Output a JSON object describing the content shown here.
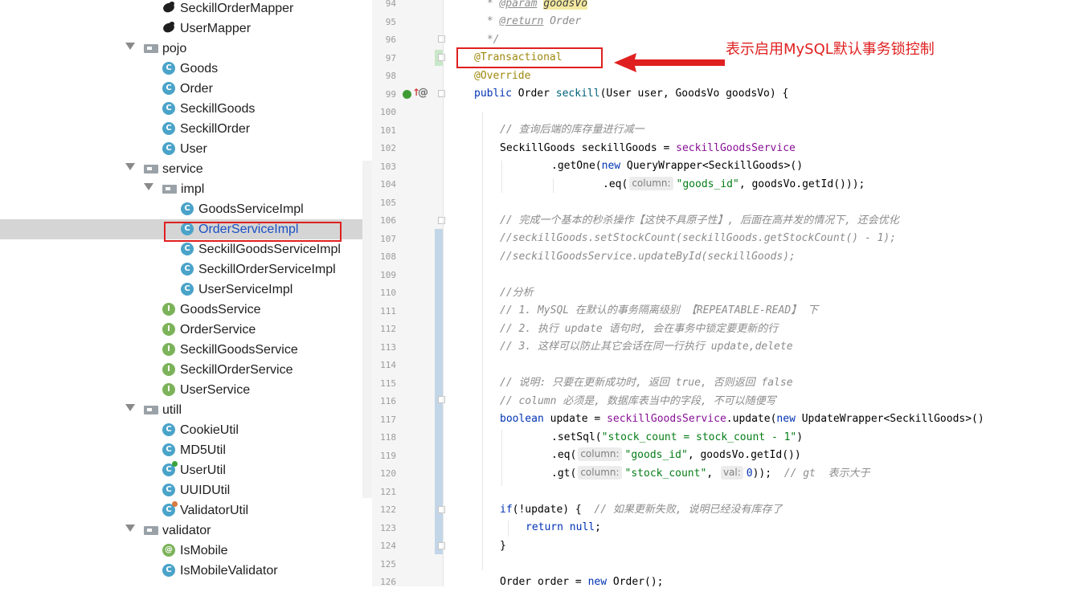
{
  "project_tree": {
    "rows": [
      {
        "label": "SeckillOrderMapper",
        "kind": "mapper",
        "indent": 2
      },
      {
        "label": "UserMapper",
        "kind": "mapper",
        "indent": 2
      },
      {
        "label": "pojo",
        "kind": "package",
        "indent": 1,
        "expanded": true
      },
      {
        "label": "Goods",
        "kind": "class",
        "indent": 2
      },
      {
        "label": "Order",
        "kind": "class",
        "indent": 2
      },
      {
        "label": "SeckillGoods",
        "kind": "class",
        "indent": 2
      },
      {
        "label": "SeckillOrder",
        "kind": "class",
        "indent": 2
      },
      {
        "label": "User",
        "kind": "class",
        "indent": 2
      },
      {
        "label": "service",
        "kind": "package",
        "indent": 1,
        "expanded": true
      },
      {
        "label": "impl",
        "kind": "package",
        "indent": 2,
        "expanded": true
      },
      {
        "label": "GoodsServiceImpl",
        "kind": "class",
        "indent": 3
      },
      {
        "label": "OrderServiceImpl",
        "kind": "class",
        "indent": 3,
        "selected": true
      },
      {
        "label": "SeckillGoodsServiceImpl",
        "kind": "class",
        "indent": 3
      },
      {
        "label": "SeckillOrderServiceImpl",
        "kind": "class",
        "indent": 3
      },
      {
        "label": "UserServiceImpl",
        "kind": "class",
        "indent": 3
      },
      {
        "label": "GoodsService",
        "kind": "interface",
        "indent": 2
      },
      {
        "label": "OrderService",
        "kind": "interface",
        "indent": 2
      },
      {
        "label": "SeckillGoodsService",
        "kind": "interface",
        "indent": 2
      },
      {
        "label": "SeckillOrderService",
        "kind": "interface",
        "indent": 2
      },
      {
        "label": "UserService",
        "kind": "interface",
        "indent": 2
      },
      {
        "label": "utill",
        "kind": "package",
        "indent": 1,
        "expanded": true
      },
      {
        "label": "CookieUtil",
        "kind": "class",
        "indent": 2
      },
      {
        "label": "MD5Util",
        "kind": "class",
        "indent": 2
      },
      {
        "label": "UserUtil",
        "kind": "class-run",
        "indent": 2
      },
      {
        "label": "UUIDUtil",
        "kind": "class",
        "indent": 2
      },
      {
        "label": "ValidatorUtil",
        "kind": "class-warn",
        "indent": 2
      },
      {
        "label": "validator",
        "kind": "package",
        "indent": 1,
        "expanded": true
      },
      {
        "label": "IsMobile",
        "kind": "annotation",
        "indent": 2
      },
      {
        "label": "IsMobileValidator",
        "kind": "class",
        "indent": 2
      }
    ]
  },
  "editor": {
    "line_numbers": [
      "94",
      "95",
      "96",
      "97",
      "98",
      "99",
      "100",
      "101",
      "102",
      "103",
      "104",
      "105",
      "106",
      "107",
      "108",
      "109",
      "110",
      "111",
      "112",
      "113",
      "114",
      "115",
      "116",
      "117",
      "118",
      "119",
      "120",
      "121",
      "122",
      "123",
      "124",
      "125",
      "126"
    ]
  },
  "annotation": {
    "text": "表示启用MySQL默认事务锁控制",
    "color": "#e02020"
  },
  "colors": {
    "keyword": "#0033b3",
    "annotation": "#9e880d",
    "comment": "#8c8c8c",
    "string": "#067d17",
    "field": "#871094",
    "selection": "#d5d5d5",
    "highlight_box": "#e02020"
  }
}
